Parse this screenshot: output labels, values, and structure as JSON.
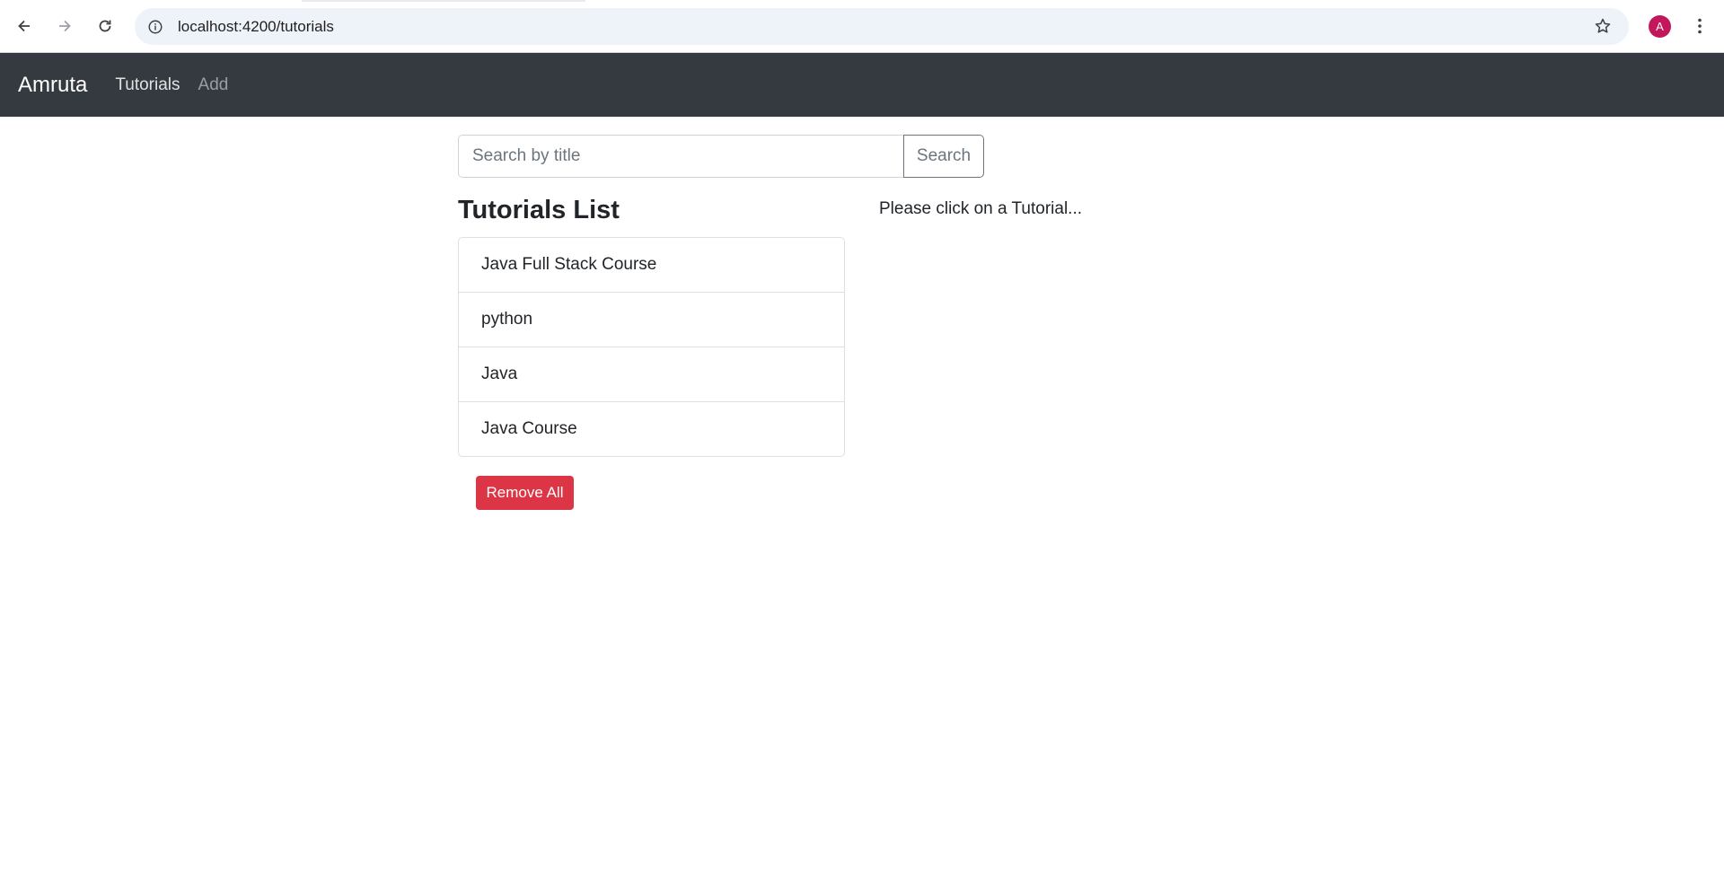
{
  "browser": {
    "url": "localhost:4200/tutorials",
    "avatar_letter": "A",
    "avatar_color": "#c2185b"
  },
  "navbar": {
    "brand": "Amruta",
    "links": [
      "Tutorials",
      "Add"
    ],
    "background": "#343a40"
  },
  "search": {
    "placeholder": "Search by title",
    "value": "",
    "button_label": "Search"
  },
  "tutorials": {
    "title": "Tutorials List",
    "items": [
      "Java Full Stack Course",
      "python",
      "Java",
      "Java Course"
    ],
    "remove_all_label": "Remove All",
    "remove_all_color": "#dc3545"
  },
  "detail": {
    "hint": "Please click on a Tutorial..."
  }
}
